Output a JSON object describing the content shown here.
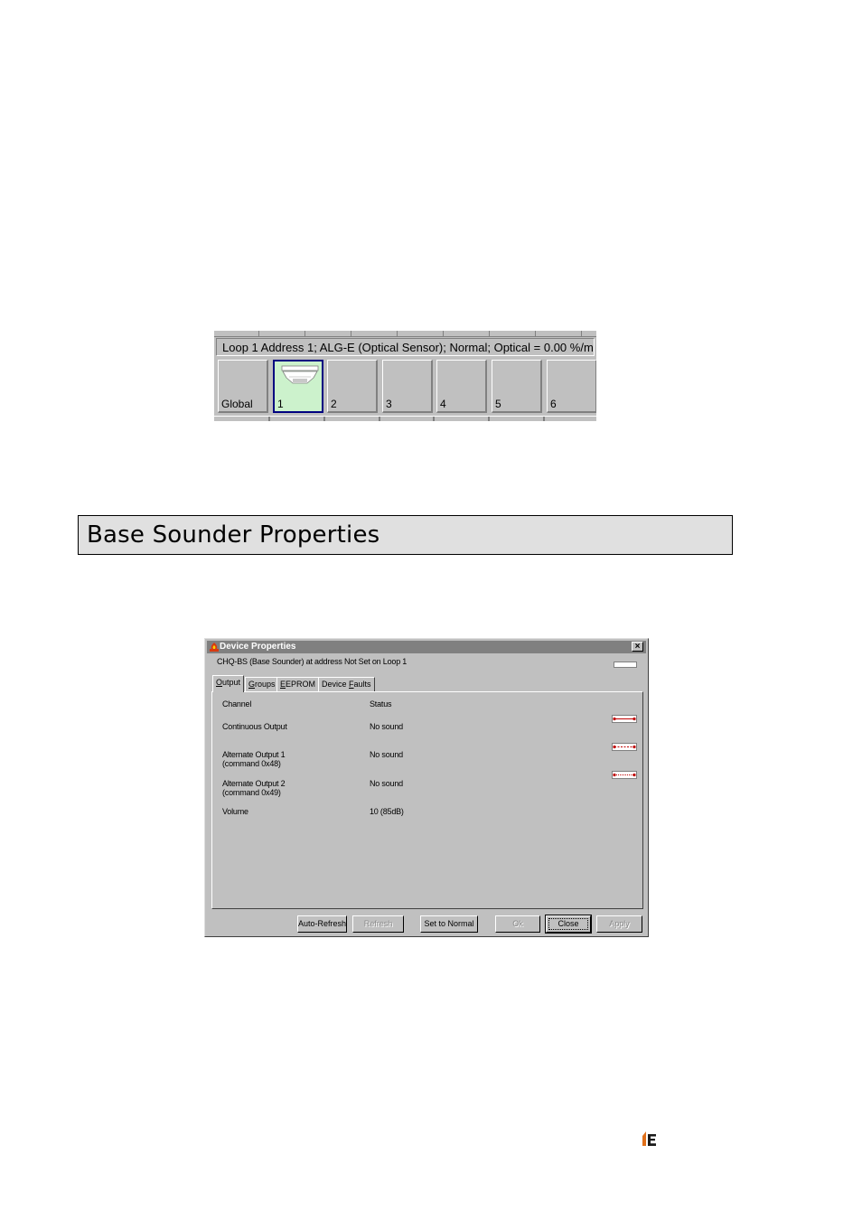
{
  "loop_strip": {
    "status_text": "Loop 1  Address 1; ALG-E (Optical Sensor); Normal; Optical = 0.00 %/m",
    "cells": [
      {
        "label": "Global",
        "selected": false
      },
      {
        "label": "1",
        "selected": true
      },
      {
        "label": "2",
        "selected": false
      },
      {
        "label": "3",
        "selected": false
      },
      {
        "label": "4",
        "selected": false
      },
      {
        "label": "5",
        "selected": false
      },
      {
        "label": "6",
        "selected": false
      }
    ],
    "selected_color": "#ccf2cc",
    "selected_border": "#000080"
  },
  "section": {
    "title": "Base Sounder Properties"
  },
  "dialog": {
    "title": "Device Properties",
    "close_glyph": "×",
    "description": "CHQ-BS (Base Sounder) at address Not Set on Loop 1",
    "tabs": [
      {
        "pre": "",
        "accel": "O",
        "post": "utput",
        "active": true
      },
      {
        "pre": "",
        "accel": "G",
        "post": "roups",
        "active": false
      },
      {
        "pre": "",
        "accel": "E",
        "post": "EPROM",
        "active": false
      },
      {
        "pre": "Device ",
        "accel": "F",
        "post": "aults",
        "active": false
      }
    ],
    "columns": {
      "channel": "Channel",
      "status": "Status"
    },
    "rows": [
      {
        "channel": "Continuous Output",
        "channel_line2": "",
        "status": "No sound"
      },
      {
        "channel": "Alternate Output 1",
        "channel_line2": "(command 0x48)",
        "status": "No sound"
      },
      {
        "channel": "Alternate Output 2",
        "channel_line2": "(command 0x49)",
        "status": "No sound"
      },
      {
        "channel": "Volume",
        "channel_line2": "",
        "status": "10  (85dB)"
      }
    ],
    "buttons": {
      "auto_refresh": "Auto-Refresh",
      "refresh": "Refresh",
      "set_to_normal": "Set to Normal",
      "ok": "Ok",
      "close": "Close",
      "apply": "Apply"
    },
    "titlebar_color": "#808080",
    "face_color": "#c0c0c0"
  },
  "icons": {
    "app": "fire-flame-icon",
    "detector": "smoke-detector-icon",
    "output_indicator": "output-indicator-icon",
    "logo": "company-logo-icon"
  }
}
